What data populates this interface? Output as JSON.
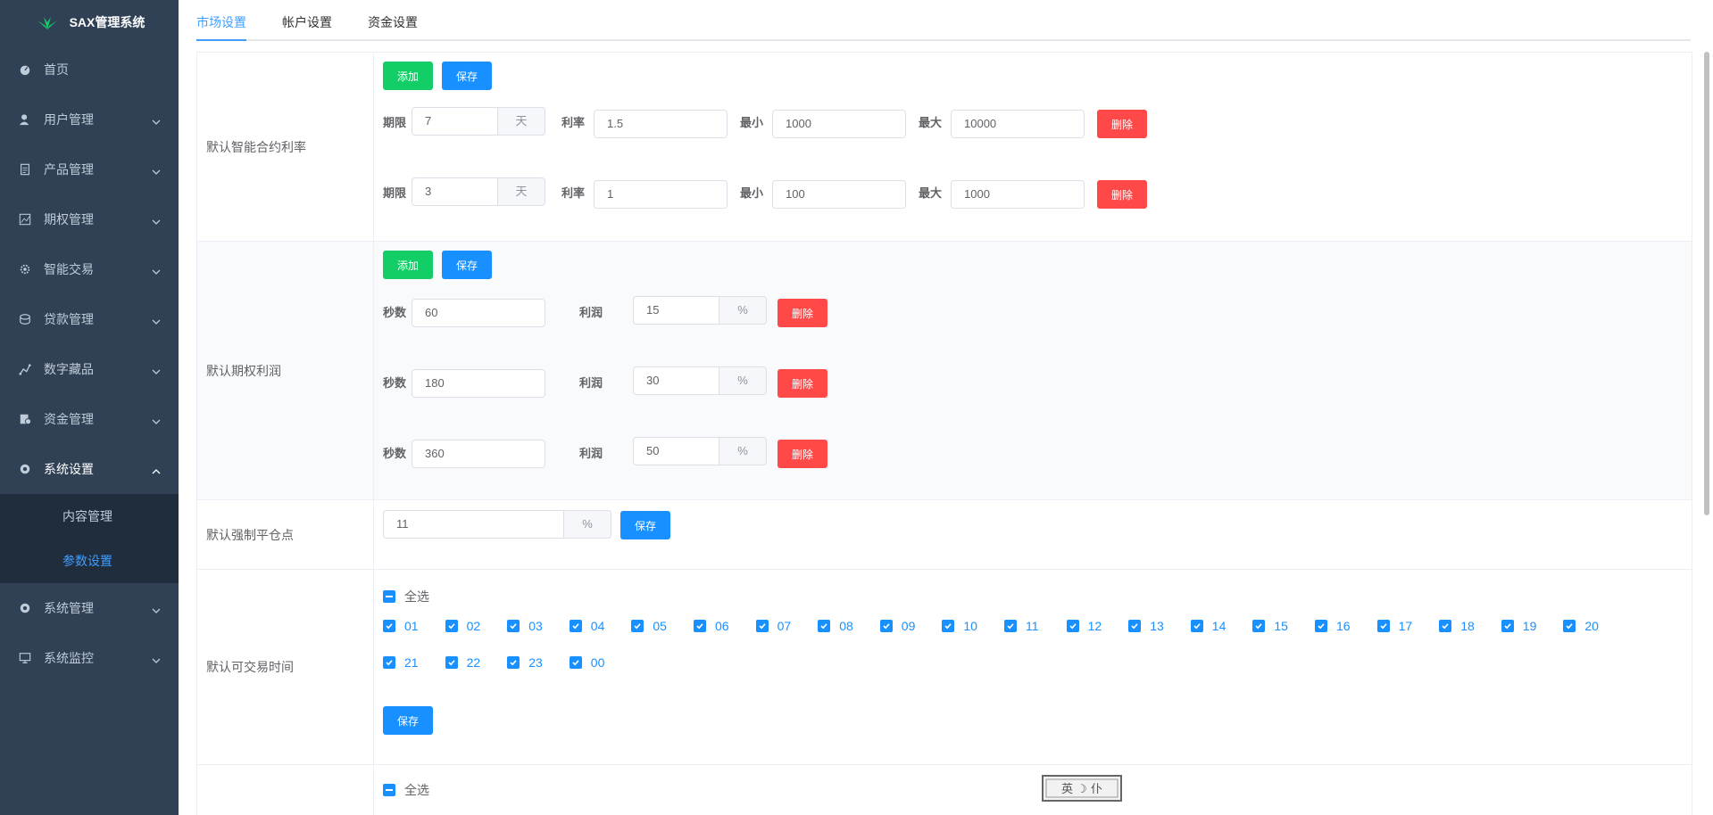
{
  "app": {
    "title": "SAX管理系统"
  },
  "sidebar": {
    "items": [
      {
        "label": "首页",
        "icon": "dashboard-icon"
      },
      {
        "label": "用户管理",
        "icon": "user-icon"
      },
      {
        "label": "产品管理",
        "icon": "document-icon"
      },
      {
        "label": "期权管理",
        "icon": "chart-icon"
      },
      {
        "label": "智能交易",
        "icon": "gear-icon"
      },
      {
        "label": "贷款管理",
        "icon": "coins-icon"
      },
      {
        "label": "数字藏品",
        "icon": "nft-icon"
      },
      {
        "label": "资金管理",
        "icon": "money-icon"
      },
      {
        "label": "系统设置",
        "icon": "settings-icon"
      },
      {
        "label": "系统管理",
        "icon": "settings-icon"
      },
      {
        "label": "系统监控",
        "icon": "monitor-icon"
      }
    ],
    "sub_items": [
      {
        "label": "内容管理"
      },
      {
        "label": "参数设置"
      }
    ]
  },
  "tabs": [
    {
      "label": "市场设置"
    },
    {
      "label": "帐户设置"
    },
    {
      "label": "资金设置"
    }
  ],
  "buttons": {
    "add": "添加",
    "save": "保存",
    "delete": "删除"
  },
  "labels": {
    "period": "期限",
    "rate": "利率",
    "min": "最小",
    "max": "最大",
    "seconds": "秒数",
    "profit": "利润",
    "day": "天",
    "percent": "%",
    "select_all": "全选"
  },
  "contract_rate": {
    "label": "默认智能合约利率",
    "rows": [
      {
        "period": "7",
        "rate": "1.5",
        "min": "1000",
        "max": "10000"
      },
      {
        "period": "3",
        "rate": "1",
        "min": "100",
        "max": "1000"
      }
    ]
  },
  "option_profit": {
    "label": "默认期权利润",
    "rows": [
      {
        "seconds": "60",
        "profit": "15"
      },
      {
        "seconds": "180",
        "profit": "30"
      },
      {
        "seconds": "360",
        "profit": "50"
      }
    ]
  },
  "liquidation": {
    "label": "默认强制平仓点",
    "value": "11"
  },
  "trade_time": {
    "label": "默认可交易时间",
    "hours": [
      "01",
      "02",
      "03",
      "04",
      "05",
      "06",
      "07",
      "08",
      "09",
      "10",
      "11",
      "12",
      "13",
      "14",
      "15",
      "16",
      "17",
      "18",
      "19",
      "20",
      "21",
      "22",
      "23",
      "00"
    ]
  },
  "ime": {
    "text": "英 ☽ 仆"
  }
}
